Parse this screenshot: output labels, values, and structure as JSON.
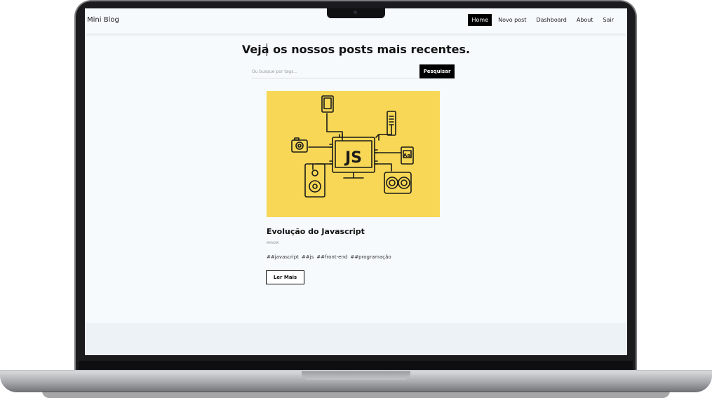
{
  "app": {
    "brand": "Mini Blog"
  },
  "nav": {
    "items": [
      {
        "label": "Home",
        "active": true
      },
      {
        "label": "Novo post",
        "active": false
      },
      {
        "label": "Dashboard",
        "active": false
      },
      {
        "label": "About",
        "active": false
      },
      {
        "label": "Sair",
        "active": false
      }
    ]
  },
  "main": {
    "heading": "Veja os nossos posts mais recentes.",
    "search": {
      "placeholder": "Ou busque por tags...",
      "value": "",
      "button_label": "Pesquisar"
    }
  },
  "post": {
    "image_icon": "javascript-devices-illustration",
    "image_text": "JS",
    "title": "Evolução do Javascript",
    "author": "MANOW",
    "tags": [
      "##javascript",
      "##js",
      "##front-end",
      "##programação"
    ],
    "read_more_label": "Ler Mais"
  },
  "colors": {
    "accent": "#000000",
    "image_bg": "#f7d755",
    "page_bg": "#f6fafd",
    "footer_bg": "#edf2f6"
  }
}
